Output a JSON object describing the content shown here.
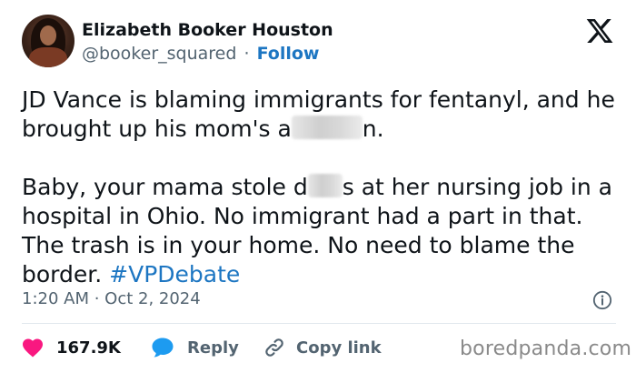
{
  "author": {
    "name": "Elizabeth Booker Houston",
    "handle": "@booker_squared",
    "separator": "·",
    "follow_label": "Follow"
  },
  "tweet": {
    "p1_before": "JD Vance is blaming immigrants for fentanyl, and he brought up his mom's a",
    "p1_after": "n.",
    "p2_before": "Baby, your mama stole d",
    "p2_after": "s at her nursing job in a hospital in Ohio. No immigrant had a part in that. The trash is in your home. No need to blame the border. ",
    "hashtag": "#VPDebate"
  },
  "meta": {
    "timestamp": "1:20 AM · Oct 2, 2024"
  },
  "actions": {
    "like_count": "167.9K",
    "reply_label": "Reply",
    "copy_label": "Copy link"
  },
  "watermark": "boredpanda.com",
  "colors": {
    "accent": "#1d76c2",
    "like": "#f91880",
    "reply": "#1d9bf0",
    "muted": "#536471",
    "text": "#0f1419"
  },
  "icons": {
    "logo": "x-logo-icon",
    "info": "info-icon",
    "like": "heart-icon",
    "reply": "speech-bubble-icon",
    "copy": "link-icon"
  }
}
